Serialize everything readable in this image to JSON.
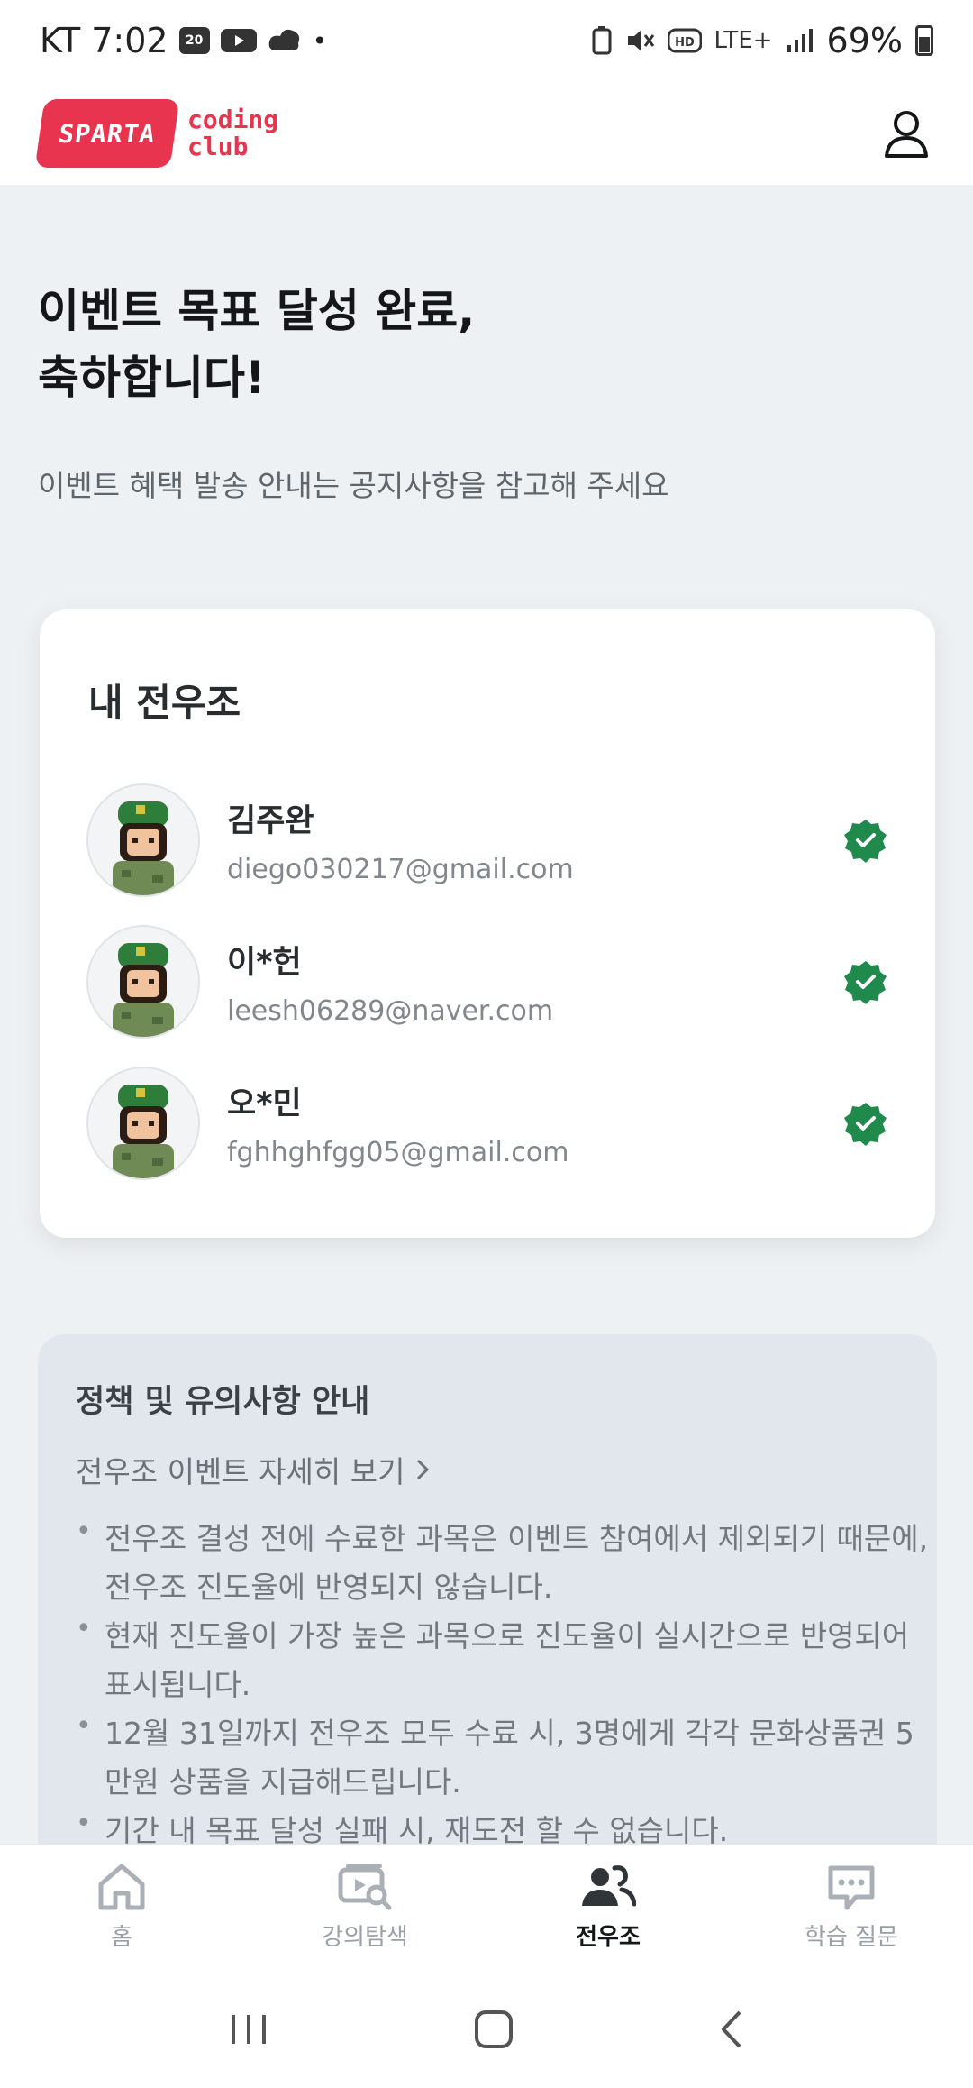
{
  "status_bar": {
    "carrier_time": "KT 7:02",
    "network": "LTE+",
    "battery": "69%"
  },
  "app": {
    "logo_badge": "SPARTA",
    "logo_text_line1": "coding",
    "logo_text_line2": "club"
  },
  "page": {
    "title_line1": "이벤트 목표 달성 완료,",
    "title_line2": "축하합니다!",
    "subtitle": "이벤트 혜택 발송 안내는 공지사항을 참고해 주세요"
  },
  "team": {
    "title": "내 전우조",
    "members": [
      {
        "name": "김주완",
        "email": "diego030217@gmail.com",
        "completed": true
      },
      {
        "name": "이*헌",
        "email": "leesh06289@naver.com",
        "completed": true
      },
      {
        "name": "오*민",
        "email": "fghhghfgg05@gmail.com",
        "completed": true
      }
    ]
  },
  "policy": {
    "title": "정책 및 유의사항 안내",
    "link_label": "전우조 이벤트 자세히 보기",
    "items": [
      "전우조 결성 전에 수료한 과목은 이벤트 참여에서 제외되기 때문에, 전우조 진도율에 반영되지 않습니다.",
      "현재 진도율이 가장 높은 과목으로 진도율이 실시간으로 반영되어 표시됩니다.",
      "12월 31일까지 전우조 모두 수료 시, 3명에게 각각 문화상품권 5만원 상품을 지급해드립니다.",
      "기간 내 목표 달성 실패 시, 재도전 할 수 없습니다."
    ]
  },
  "bottom_nav": {
    "items": [
      {
        "label": "홈",
        "icon": "home-icon",
        "active": false
      },
      {
        "label": "강의탐색",
        "icon": "video-search-icon",
        "active": false
      },
      {
        "label": "전우조",
        "icon": "team-icon",
        "active": true
      },
      {
        "label": "학습 질문",
        "icon": "chat-icon",
        "active": false
      }
    ]
  },
  "colors": {
    "brand": "#e8344e",
    "check_green": "#1f8a4c",
    "background": "#eef1f4"
  }
}
